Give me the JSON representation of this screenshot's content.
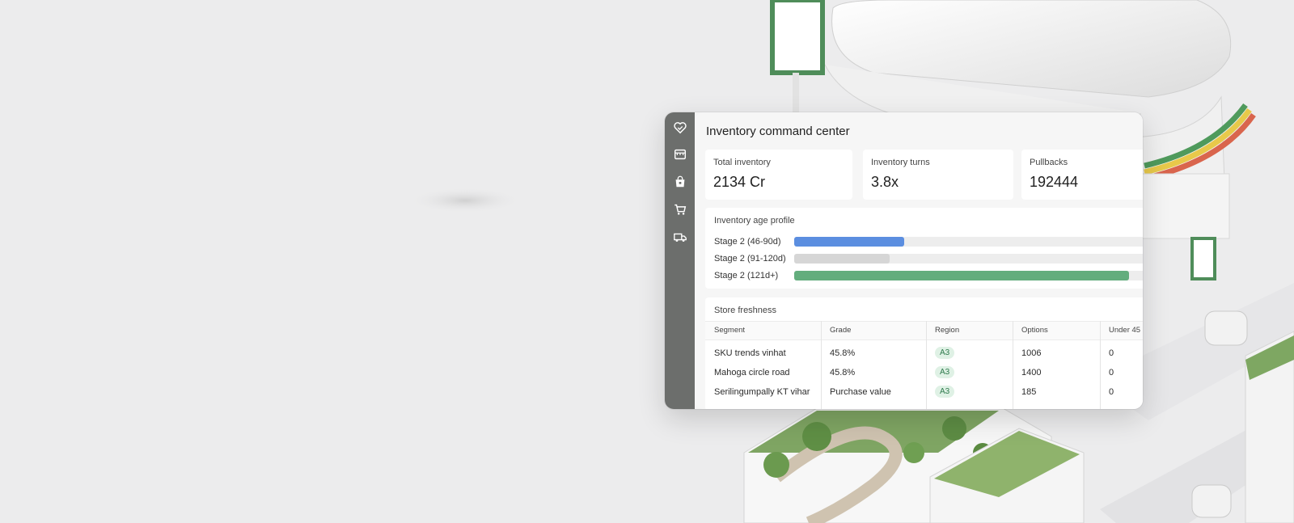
{
  "app": {
    "title": "Inventory command center"
  },
  "rail": {
    "items": [
      {
        "icon": "brand-heart-icon"
      },
      {
        "icon": "storefront-icon"
      },
      {
        "icon": "shopping-bag-icon"
      },
      {
        "icon": "shopping-cart-icon"
      },
      {
        "icon": "delivery-truck-icon"
      }
    ]
  },
  "kpis": [
    {
      "label": "Total inventory",
      "value": "2134 Cr"
    },
    {
      "label": "Inventory turns",
      "value": "3.8x"
    },
    {
      "label": "Pullbacks",
      "value": "192444"
    }
  ],
  "age_profile": {
    "title": "Inventory age profile",
    "rows": [
      {
        "label": "Stage 2 (46-90d)",
        "level": 0.29,
        "color": "#5b8ee0"
      },
      {
        "label": "Stage 2 (91-120d)",
        "level": 0.25,
        "color": "#d6d6d6"
      },
      {
        "label": "Stage 2 (121d+)",
        "level": 0.88,
        "color": "#63ad7d"
      }
    ]
  },
  "freshness": {
    "title": "Store freshness",
    "columns": [
      "Segment",
      "Grade",
      "Region",
      "Options",
      "Under 45"
    ],
    "rows": [
      {
        "segment": "SKU trends vinhat",
        "grade": "45.8%",
        "region": "A3",
        "options": "1006",
        "under": "0"
      },
      {
        "segment": "Mahoga circle road",
        "grade": "45.8%",
        "region": "A3",
        "options": "1400",
        "under": "0"
      },
      {
        "segment": "Serilingumpally KT vihar",
        "grade": "Purchase value",
        "region": "A3",
        "options": "185",
        "under": "0"
      }
    ]
  },
  "colors": {
    "rail": "#6c6e6c",
    "accent_green": "#63ad7d",
    "accent_blue": "#5b8ee0",
    "pill_bg": "#dff1e5"
  }
}
